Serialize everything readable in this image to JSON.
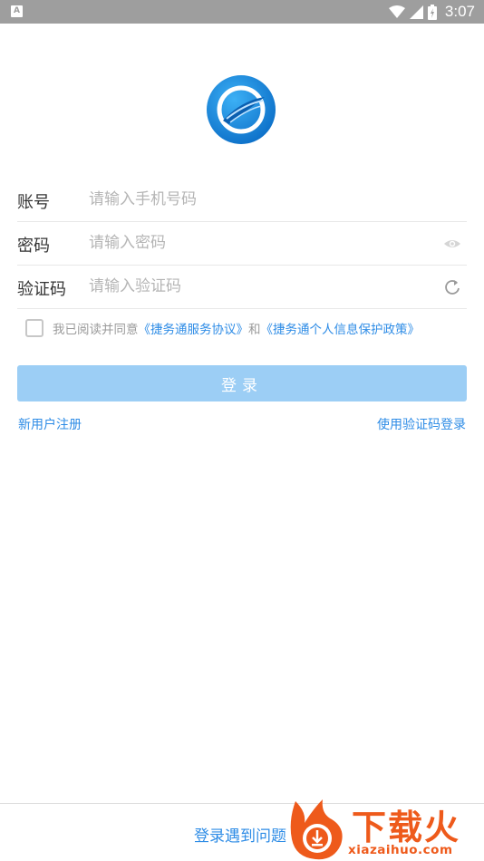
{
  "status_bar": {
    "app_icon_letter": "A",
    "time": "3:07"
  },
  "logo": {
    "icon": "jiewutong-logo-icon",
    "color": "#1a8fe6"
  },
  "form": {
    "account": {
      "label": "账号",
      "placeholder": "请输入手机号码"
    },
    "password": {
      "label": "密码",
      "placeholder": "请输入密码",
      "icon": "eye-icon"
    },
    "captcha": {
      "label": "验证码",
      "placeholder": "请输入验证码",
      "icon": "refresh-icon"
    }
  },
  "agreement": {
    "prefix": "我已阅读并同意",
    "service_link": "《捷务通服务协议》",
    "joiner": "和",
    "privacy_link": "《捷务通个人信息保护政策》",
    "checked": false
  },
  "login_button": {
    "label": "登录",
    "color": "#9ccef5"
  },
  "links": {
    "register": "新用户注册",
    "sms_login": "使用验证码登录"
  },
  "footer": {
    "help": "登录遇到问题"
  },
  "watermark": {
    "title": "下载火",
    "url": "xiazaihuo.com",
    "color": "#ee5a1b"
  }
}
